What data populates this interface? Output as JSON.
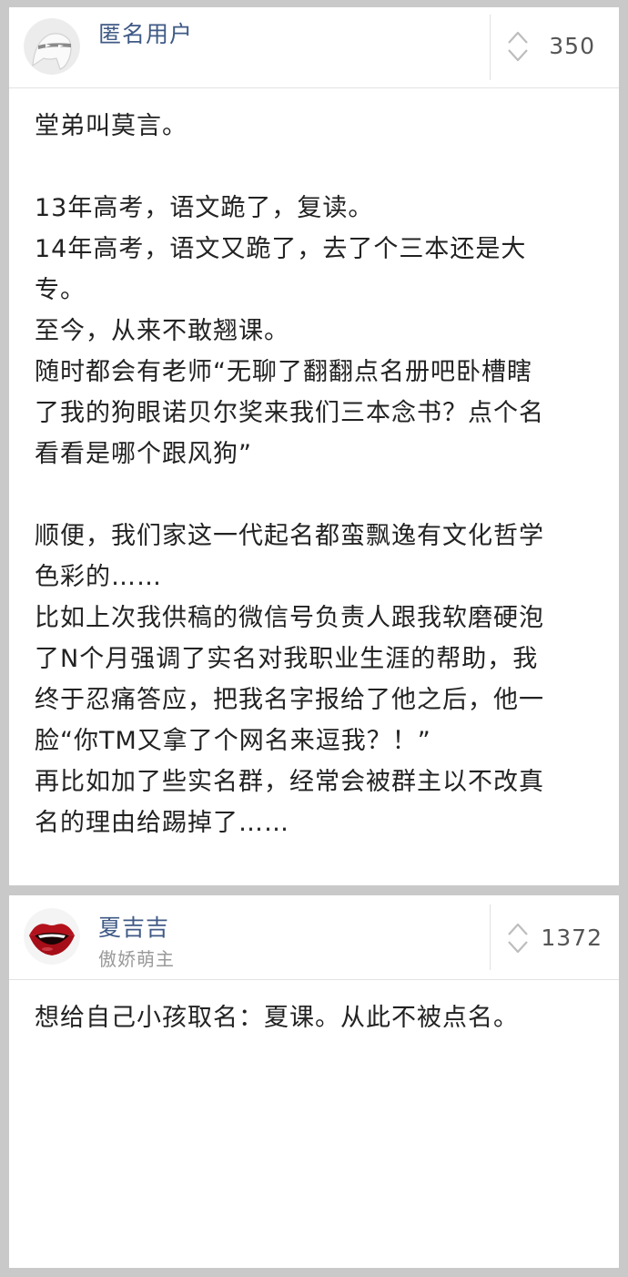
{
  "posts": [
    {
      "author": "匿名用户",
      "votes": "350",
      "lines": [
        "堂弟叫莫言。",
        "",
        "13年高考，语文跪了，复读。",
        "14年高考，语文又跪了，去了个三本还是大",
        "专。",
        "至今，从来不敢翘课。",
        "随时都会有老师“无聊了翻翻点名册吧卧槽瞎",
        "了我的狗眼诺贝尔奖来我们三本念书？点个名",
        "看看是哪个跟风狗”",
        "",
        "顺便，我们家这一代起名都蛮飘逸有文化哲学",
        "色彩的……",
        "比如上次我供稿的微信号负责人跟我软磨硬泡",
        "了N个月强调了实名对我职业生涯的帮助，我",
        "终于忍痛答应，把我名字报给了他之后，他一",
        "脸“你TM又拿了个网名来逗我？！”",
        "再比如加了些实名群，经常会被群主以不改真",
        "名的理由给踢掉了……"
      ]
    },
    {
      "author": "夏吉吉",
      "author_title": "傲娇萌主",
      "votes": "1372",
      "lines": [
        "想给自己小孩取名：夏课。从此不被点名。"
      ]
    }
  ],
  "icons": {
    "avatar1": "anonymous-mask-avatar",
    "avatar2": "red-lips-avatar",
    "vote": "vote-up-down-icon"
  },
  "colors": {
    "author_name": "#3f5a86",
    "page_bg": "#c9c9c9"
  }
}
